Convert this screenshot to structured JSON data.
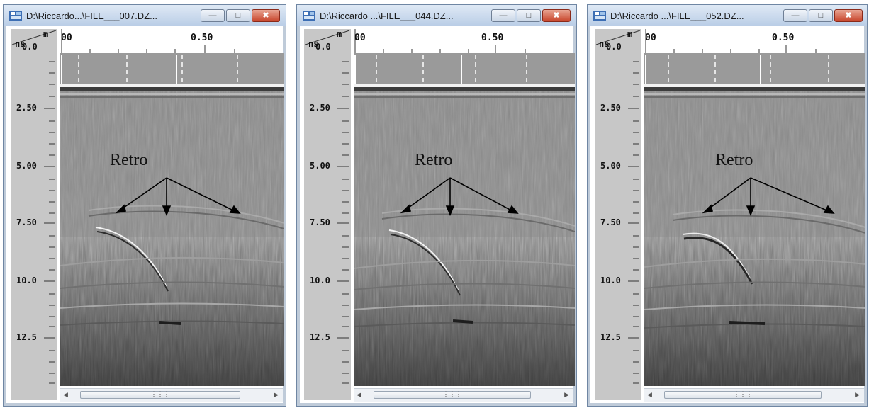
{
  "windows": [
    {
      "title": "D:\\Riccardo...\\FILE___007.DZ...",
      "x_ticks": [
        "00",
        "0.50"
      ],
      "y_unit_distance": "m",
      "y_unit_time": "ns",
      "y_ticks": [
        "0.0",
        "2.50",
        "5.00",
        "7.50",
        "10.0",
        "12.5"
      ],
      "annotation": "Retro"
    },
    {
      "title": "D:\\Riccardo ...\\FILE___044.DZ...",
      "x_ticks": [
        "00",
        "0.50"
      ],
      "y_unit_distance": "m",
      "y_unit_time": "ns",
      "y_ticks": [
        "0.0",
        "2.50",
        "5.00",
        "7.50",
        "10.0",
        "12.5"
      ],
      "annotation": "Retro"
    },
    {
      "title": "D:\\Riccardo ...\\FILE___052.DZ...",
      "x_ticks": [
        "00",
        "0.50"
      ],
      "y_unit_distance": "m",
      "y_unit_time": "ns",
      "y_ticks": [
        "0.0",
        "2.50",
        "5.00",
        "7.50",
        "10.0",
        "12.5"
      ],
      "annotation": "Retro"
    }
  ],
  "window_controls": {
    "minimize": "minimize-icon",
    "maximize": "maximize-icon",
    "close": "close-icon",
    "scroll_left": "chevron-left-icon",
    "scroll_right": "chevron-right-icon",
    "scroll_grip": "grip-icon"
  },
  "colors": {
    "titlebar": "#c8d8ec",
    "close_button": "#c8452b",
    "radargram_background": "#8a8a8a",
    "axis_panel": "#c7c7c7"
  }
}
